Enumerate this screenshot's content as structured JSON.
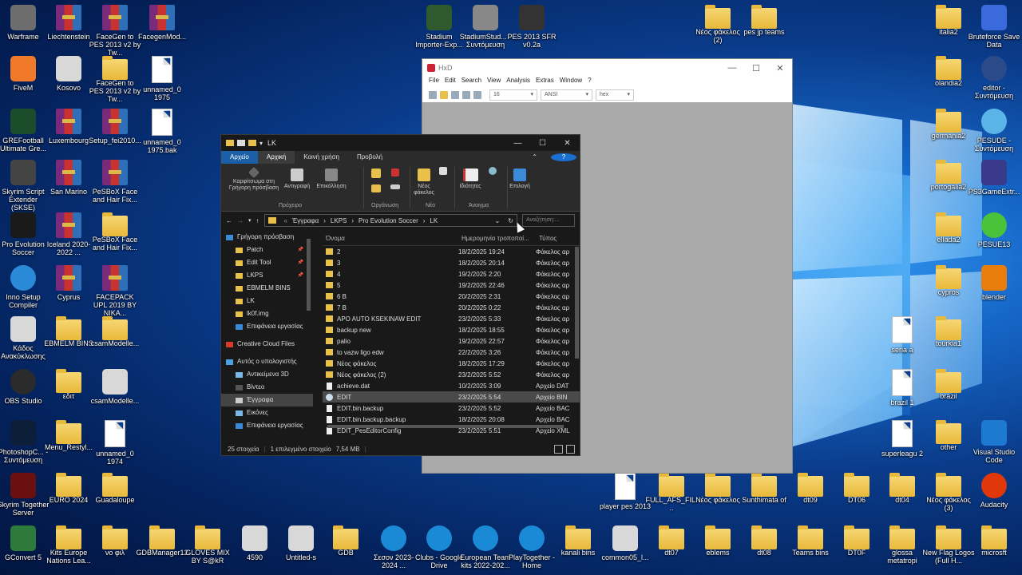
{
  "desktop_icons": [
    {
      "label": "Warframe",
      "icon": "warframe-icon",
      "color": "#6d6d6d"
    },
    {
      "label": "Liechtenstein",
      "icon": "rar-icon"
    },
    {
      "label": "FaceGen to PES 2013 v2 by Tw...",
      "icon": "rar-icon"
    },
    {
      "label": "FacegenMod...",
      "icon": "rar-icon"
    },
    {
      "label": "FiveM",
      "icon": "fivem-icon",
      "color": "#f07a2a"
    },
    {
      "label": "Kosovo",
      "icon": "archive-z-icon"
    },
    {
      "label": "FaceGen to PES 2013 v2 by Tw...",
      "icon": "folder-icon"
    },
    {
      "label": "unnamed_0 1975",
      "icon": "file-icon"
    },
    {
      "label": "GREFootball Ultimate Gre...",
      "icon": "grefootball-icon",
      "color": "#1b4d2b"
    },
    {
      "label": "Luxembourg",
      "icon": "rar-icon"
    },
    {
      "label": "Setup_fei2010...",
      "icon": "rar-icon"
    },
    {
      "label": "unnamed_0 1975.bak",
      "icon": "file-icon"
    },
    {
      "label": "Skyrim Script Extender (SKSE)",
      "icon": "gear-icon",
      "color": "#444444"
    },
    {
      "label": "San Marino",
      "icon": "rar-icon"
    },
    {
      "label": "PeSBoX Face and Hair Fix...",
      "icon": "rar-icon"
    },
    {
      "label": "Pro Evolution Soccer",
      "icon": "pes-icon",
      "color": "#1a1a1a"
    },
    {
      "label": "Iceland 2020-2022 ...",
      "icon": "rar-icon"
    },
    {
      "label": "PeSBoX Face and Hair Fix...",
      "icon": "folder-icon"
    },
    {
      "label": "Inno Setup Compiler",
      "icon": "inno-setup-icon",
      "color": "#2a8ad8"
    },
    {
      "label": "Cyprus",
      "icon": "rar-icon"
    },
    {
      "label": "FACEPACK UPL 2019 BY NIKA...",
      "icon": "rar-icon"
    },
    {
      "label": "Κάδος Ανακύκλωσης",
      "icon": "recycle-bin-icon"
    },
    {
      "label": "EBMELM BINS",
      "icon": "folder-icon"
    },
    {
      "label": "csamModelle...",
      "icon": "folder-icon"
    },
    {
      "label": "OBS Studio",
      "icon": "obs-icon",
      "color": "#2b2b2b"
    },
    {
      "label": "εδιτ",
      "icon": "folder-icon"
    },
    {
      "label": "csamModelle...",
      "icon": "archive-7z-icon"
    },
    {
      "label": "PhotoshopC... - Συντόμευση",
      "icon": "photoshop-icon",
      "color": "#0d1e3a"
    },
    {
      "label": "Menu_Restyl...",
      "icon": "folder-icon"
    },
    {
      "label": "unnamed_0 1974",
      "icon": "file-icon"
    },
    {
      "label": "Skyrim Together Server",
      "icon": "skyrim-icon",
      "color": "#6a1010"
    },
    {
      "label": "EURO 2024",
      "icon": "folder-icon"
    },
    {
      "label": "Guadaloupe",
      "icon": "folder-icon"
    },
    {
      "label": "GConvert 5",
      "icon": "gconvert-icon",
      "color": "#2d7a3a"
    },
    {
      "label": "Kits Europe Nations Lea...",
      "icon": "folder-icon"
    },
    {
      "label": "νο φιλ",
      "icon": "folder-icon"
    },
    {
      "label": "GDBManager12",
      "icon": "folder-icon"
    },
    {
      "label": "GLOVES MIX BY S@kR",
      "icon": "folder-icon"
    },
    {
      "label": "4590",
      "icon": "image-icon"
    },
    {
      "label": "Untitled-s",
      "icon": "image-icon"
    },
    {
      "label": "GDB",
      "icon": "folder-icon"
    },
    {
      "label": "Σεσον 2023-2024 ...",
      "icon": "edge-icon",
      "color": "#1b8ad6"
    },
    {
      "label": "Clubs - Google Drive",
      "icon": "edge-icon",
      "color": "#1b8ad6"
    },
    {
      "label": "European Team kits 2022-202...",
      "icon": "edge-icon",
      "color": "#1b8ad6"
    },
    {
      "label": "PlayTogether - Home",
      "icon": "edge-icon",
      "color": "#1b8ad6"
    },
    {
      "label": "kanali bins",
      "icon": "folder-icon"
    },
    {
      "label": "common05_l...",
      "icon": "image-icon"
    },
    {
      "label": "dt07",
      "icon": "folder-icon"
    },
    {
      "label": "eblems",
      "icon": "folder-icon"
    },
    {
      "label": "dt08",
      "icon": "folder-icon"
    },
    {
      "label": "Teams bins",
      "icon": "folder-icon"
    },
    {
      "label": "DT0F",
      "icon": "folder-icon"
    },
    {
      "label": "glossa metatropi",
      "icon": "folder-icon"
    },
    {
      "label": "New Flag Logos (Full H...",
      "icon": "folder-icon"
    },
    {
      "label": "microsft",
      "icon": "folder-icon"
    },
    {
      "label": "Stadium Importer-Exp...",
      "icon": "stadium-icon",
      "color": "#2e5a2e"
    },
    {
      "label": "StadiumStud... - Συντόμευση",
      "icon": "stadium-studio-icon",
      "color": "#888888"
    },
    {
      "label": "PES 2013 SFR v0.2a",
      "icon": "pes2013-icon",
      "color": "#333333"
    },
    {
      "label": "Νέος φάκελος (2)",
      "icon": "folder-icon"
    },
    {
      "label": "pes jp teams",
      "icon": "folder-icon"
    },
    {
      "label": "italia2",
      "icon": "folder-icon"
    },
    {
      "label": "Bruteforce Save Data",
      "icon": "bruteforce-icon",
      "color": "#3a6adc"
    },
    {
      "label": "olandia2",
      "icon": "folder-icon"
    },
    {
      "label": "editor - Συντόμευση",
      "icon": "editor-icon",
      "color": "#2a4a8a"
    },
    {
      "label": "germania2",
      "icon": "folder-icon"
    },
    {
      "label": "PESUDE - Συντόμευση",
      "icon": "pesude-icon",
      "color": "#5ab4e8"
    },
    {
      "label": "portogalia2",
      "icon": "folder-icon"
    },
    {
      "label": "PS3GameExtr...",
      "icon": "ps3-icon",
      "color": "#3a3a8a"
    },
    {
      "label": "ellada2",
      "icon": "folder-icon"
    },
    {
      "label": "PESUE13",
      "icon": "pesue-icon",
      "color": "#4ac23a"
    },
    {
      "label": "cypros",
      "icon": "folder-icon"
    },
    {
      "label": "blender",
      "icon": "blender-icon",
      "color": "#e87d0d"
    },
    {
      "label": "seria a",
      "icon": "file-icon"
    },
    {
      "label": "tourkia1",
      "icon": "folder-icon"
    },
    {
      "label": "brazil 1",
      "icon": "file-icon"
    },
    {
      "label": "brazil",
      "icon": "folder-icon"
    },
    {
      "label": "superleagu 2",
      "icon": "file-icon"
    },
    {
      "label": "other",
      "icon": "folder-icon"
    },
    {
      "label": "Visual Studio Code",
      "icon": "vscode-icon",
      "color": "#1e7ad0"
    },
    {
      "label": "player pes 2013",
      "icon": "file-icon"
    },
    {
      "label": "FULL_AFS_FIL...",
      "icon": "folder-icon"
    },
    {
      "label": "Νέος φάκελος",
      "icon": "folder-icon"
    },
    {
      "label": "Sunthimata of",
      "icon": "folder-icon"
    },
    {
      "label": "dt09",
      "icon": "folder-icon"
    },
    {
      "label": "DT06",
      "icon": "folder-icon"
    },
    {
      "label": "dt04",
      "icon": "folder-icon"
    },
    {
      "label": "Νέος φάκελος (3)",
      "icon": "folder-icon"
    },
    {
      "label": "Audacity",
      "icon": "audacity-icon",
      "color": "#e0380a"
    }
  ],
  "hxd": {
    "title": "HxD",
    "window_buttons": [
      "—",
      "☐",
      "✕"
    ],
    "menu": [
      "File",
      "Edit",
      "Search",
      "View",
      "Analysis",
      "Extras",
      "Window",
      "?"
    ],
    "bytes_per_row": "16",
    "charset": "ANSI",
    "offset_base": "hex"
  },
  "explorer": {
    "title": "LK",
    "window_buttons": [
      "—",
      "☐",
      "✕"
    ],
    "tabs": [
      "Αρχείο",
      "Αρχική",
      "Κοινή χρήση",
      "Προβολή"
    ],
    "ribbon": {
      "pin": "Καρφίτσωμα στη Γρήγορη πρόσβαση",
      "copy": "Αντιγραφή",
      "paste": "Επικόλληση",
      "new_folder": "Νέος φάκελος",
      "properties": "Ιδιότητες",
      "select": "Επιλογή",
      "group_clipboard": "Πρόχειρο",
      "group_organize": "Οργάνωση",
      "group_new": "Νέο",
      "group_open": "Άνοιγμα"
    },
    "address": [
      "«",
      "Έγγραφα",
      "›",
      "LKPS",
      "›",
      "Pro Evolution Soccer",
      "›",
      "LK"
    ],
    "search_placeholder": "Αναζήτηση:...",
    "nav": [
      {
        "label": "Γρήγορη πρόσβαση",
        "icon": "star-icon",
        "pinned": false
      },
      {
        "label": "Patch",
        "icon": "folder-icon",
        "pinned": true
      },
      {
        "label": "Edit Tool",
        "icon": "folder-icon",
        "pinned": true
      },
      {
        "label": "LKPS",
        "icon": "folder-icon",
        "pinned": true
      },
      {
        "label": "EBMELM BINS",
        "icon": "folder-icon",
        "pinned": false
      },
      {
        "label": "LK",
        "icon": "folder-icon",
        "pinned": false
      },
      {
        "label": "lk0f.img",
        "icon": "folder-icon",
        "pinned": false
      },
      {
        "label": "Επιφάνεια εργασίας",
        "icon": "desktop-icon",
        "pinned": false
      },
      {
        "label": "Creative Cloud Files",
        "icon": "cloud-icon",
        "pinned": false
      },
      {
        "label": "Αυτός ο υπολογιστής",
        "icon": "computer-icon",
        "pinned": false
      },
      {
        "label": "Αντικείμενα 3D",
        "icon": "cube-icon",
        "pinned": false
      },
      {
        "label": "Βίντεο",
        "icon": "video-icon",
        "pinned": false
      },
      {
        "label": "Έγγραφα",
        "icon": "documents-icon",
        "pinned": false,
        "selected": true
      },
      {
        "label": "Εικόνες",
        "icon": "pictures-icon",
        "pinned": false
      },
      {
        "label": "Επιφάνεια εργασίας",
        "icon": "desktop-icon",
        "pinned": false
      }
    ],
    "columns": [
      "Όνομα",
      "Ημερομηνία τροποποί...",
      "Τύπος"
    ],
    "files": [
      {
        "name": "2",
        "date": "18/2/2025 19:24",
        "type": "Φάκελος αρ",
        "kind": "folder"
      },
      {
        "name": "3",
        "date": "18/2/2025 20:14",
        "type": "Φάκελος αρ",
        "kind": "folder"
      },
      {
        "name": "4",
        "date": "19/2/2025 2:20",
        "type": "Φάκελος αρ",
        "kind": "folder"
      },
      {
        "name": "5",
        "date": "19/2/2025 22:46",
        "type": "Φάκελος αρ",
        "kind": "folder"
      },
      {
        "name": "6 B",
        "date": "20/2/2025 2:31",
        "type": "Φάκελος αρ",
        "kind": "folder"
      },
      {
        "name": "7 B",
        "date": "20/2/2025 0:22",
        "type": "Φάκελος αρ",
        "kind": "folder"
      },
      {
        "name": "APO AUTO KSEKINAW EDIT",
        "date": "23/2/2025 5:33",
        "type": "Φάκελος αρ",
        "kind": "folder"
      },
      {
        "name": "backup new",
        "date": "18/2/2025 18:55",
        "type": "Φάκελος αρ",
        "kind": "folder"
      },
      {
        "name": "palio",
        "date": "19/2/2025 22:57",
        "type": "Φάκελος αρ",
        "kind": "folder"
      },
      {
        "name": "to vazw ligo edw",
        "date": "22/2/2025 3:26",
        "type": "Φάκελος αρ",
        "kind": "folder"
      },
      {
        "name": "Νέος φάκελος",
        "date": "18/2/2025 17:29",
        "type": "Φάκελος αρ",
        "kind": "folder"
      },
      {
        "name": "Νέος φάκελος (2)",
        "date": "23/2/2025 5:52",
        "type": "Φάκελος αρ",
        "kind": "folder"
      },
      {
        "name": "achieve.dat",
        "date": "10/2/2025 3:09",
        "type": "Αρχείο DAT",
        "kind": "file"
      },
      {
        "name": "EDIT",
        "date": "23/2/2025 5:54",
        "type": "Αρχείο BIN",
        "kind": "edit",
        "selected": true
      },
      {
        "name": "EDIT.bin.backup",
        "date": "23/2/2025 5:52",
        "type": "Αρχείο BAC",
        "kind": "file"
      },
      {
        "name": "EDIT.bin.backup.backup",
        "date": "18/2/2025 20:08",
        "type": "Αρχείο BAC",
        "kind": "file"
      },
      {
        "name": "EDIT_PesEditorConfig",
        "date": "23/2/2025 5:51",
        "type": "Αρχείο XML",
        "kind": "file"
      }
    ],
    "status": {
      "count": "25 στοιχεία",
      "selected": "1 επιλεγμένο στοιχείο",
      "size": "7,54 MB"
    }
  }
}
